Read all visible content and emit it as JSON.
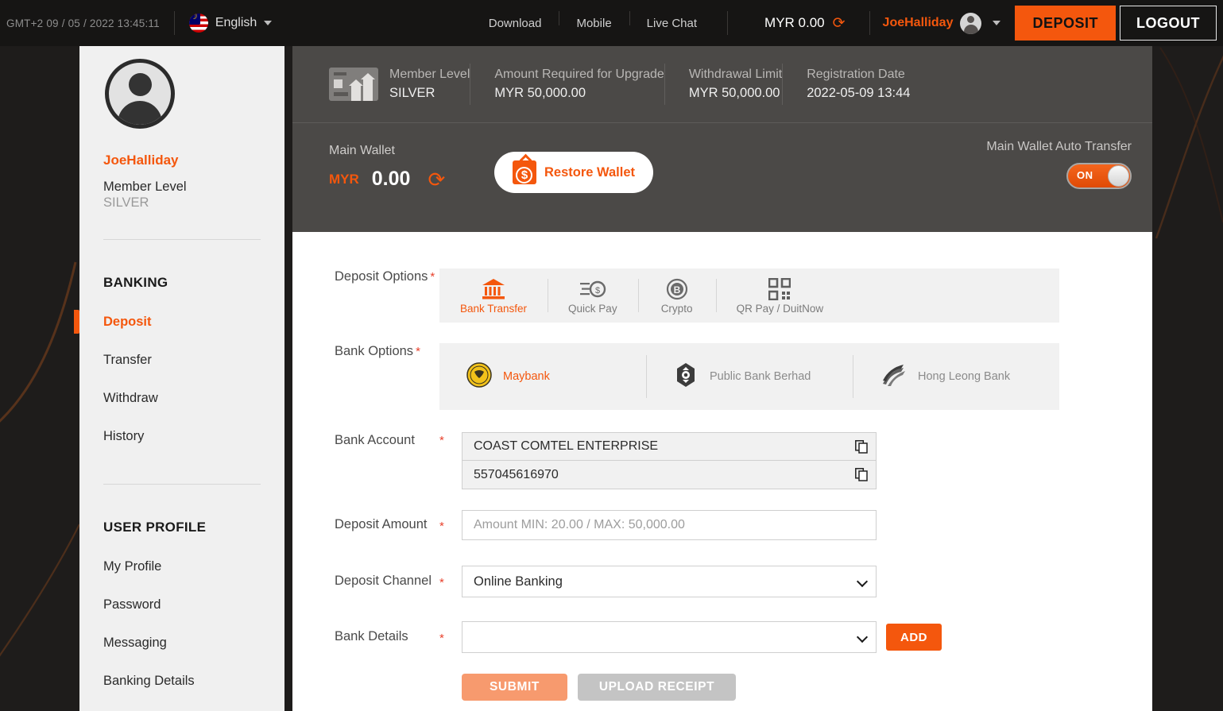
{
  "topbar": {
    "timezone_datetime": "GMT+2  09 / 05 / 2022 13:45:11",
    "language": "English",
    "language_flag_icon": "malaysia-flag-icon",
    "links": [
      {
        "label": "Download",
        "name": "nav-download"
      },
      {
        "label": "Mobile",
        "name": "nav-mobile"
      },
      {
        "label": "Live Chat",
        "name": "nav-live-chat"
      }
    ],
    "balance": "MYR 0.00",
    "refresh_icon": "refresh-icon",
    "username": "JoeHalliday",
    "deposit_label": "DEPOSIT",
    "logout_label": "LOGOUT"
  },
  "sidebar": {
    "username": "JoeHalliday",
    "member_level_label": "Member Level",
    "member_level_value": "SILVER",
    "banking_heading": "BANKING",
    "banking_items": [
      {
        "label": "Deposit",
        "active": true
      },
      {
        "label": "Transfer",
        "active": false
      },
      {
        "label": "Withdraw",
        "active": false
      },
      {
        "label": "History",
        "active": false
      }
    ],
    "profile_heading": "USER PROFILE",
    "profile_items": [
      {
        "label": "My Profile"
      },
      {
        "label": "Password"
      },
      {
        "label": "Messaging"
      },
      {
        "label": "Banking Details"
      }
    ]
  },
  "info_bar": {
    "cells": [
      {
        "label": "Member Level",
        "value": "SILVER",
        "icon": "member-card-icon"
      },
      {
        "label": "Amount Required for Upgrade",
        "value": "MYR 50,000.00"
      },
      {
        "label": "Withdrawal Limit",
        "value": "MYR 50,000.00"
      },
      {
        "label": "Registration Date",
        "value": "2022-05-09 13:44"
      }
    ]
  },
  "wallet": {
    "title": "Main Wallet",
    "currency": "MYR",
    "amount": "0.00",
    "refresh_icon": "refresh-icon",
    "restore_label": "Restore Wallet",
    "auto_transfer_label": "Main Wallet Auto Transfer",
    "toggle_state": "ON"
  },
  "form": {
    "deposit_options": {
      "label": "Deposit Options",
      "required": "*",
      "options": [
        {
          "label": "Bank Transfer",
          "icon": "bank-icon",
          "active": true
        },
        {
          "label": "Quick Pay",
          "icon": "quick-pay-icon",
          "active": false
        },
        {
          "label": "Crypto",
          "icon": "bitcoin-icon",
          "active": false
        },
        {
          "label": "QR Pay / DuitNow",
          "icon": "qr-code-icon",
          "active": false
        }
      ]
    },
    "bank_options": {
      "label": "Bank Options",
      "required": "*",
      "options": [
        {
          "label": "Maybank",
          "icon": "maybank-logo-icon",
          "active": true
        },
        {
          "label": "Public Bank Berhad",
          "icon": "public-bank-logo-icon",
          "active": false
        },
        {
          "label": "Hong Leong Bank",
          "icon": "hong-leong-logo-icon",
          "active": false
        }
      ]
    },
    "bank_account": {
      "label": "Bank Account",
      "required": "*",
      "account_name": "COAST COMTEL ENTERPRISE",
      "account_number": "557045616970",
      "copy_icon": "copy-icon"
    },
    "deposit_amount": {
      "label": "Deposit Amount",
      "required": "*",
      "value": "",
      "placeholder": "Amount MIN: 20.00 / MAX: 50,000.00"
    },
    "deposit_channel": {
      "label": "Deposit Channel",
      "required": "*",
      "selected": "Online Banking"
    },
    "bank_details": {
      "label": "Bank Details",
      "required": "*",
      "selected": "",
      "add_label": "ADD"
    },
    "actions": {
      "submit_label": "SUBMIT",
      "upload_label": "UPLOAD RECEIPT"
    }
  },
  "colors": {
    "accent": "#f4570d",
    "page_bg": "#1e1c1b",
    "panel_bg": "#4b4947",
    "sidebar_bg": "#f0f0f0"
  }
}
